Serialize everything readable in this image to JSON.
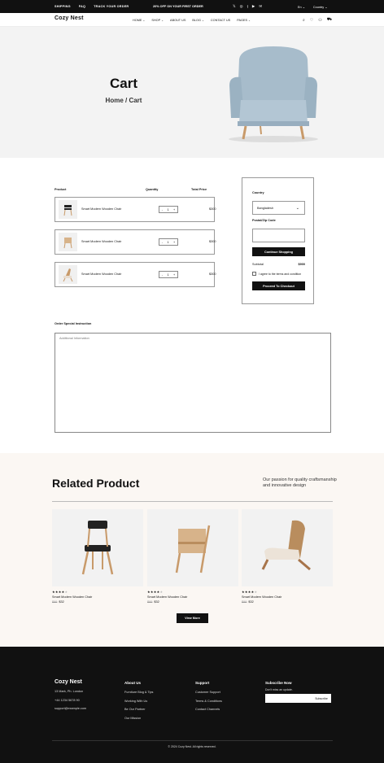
{
  "topbar": {
    "links": [
      "SHIPPING",
      "FAQ",
      "TRACK YOUR ORDER"
    ],
    "promo": "20% OFF ON YOUR FIRST ORDER",
    "social_icons": [
      "x-icon",
      "instagram-icon",
      "facebook-icon",
      "youtube-icon",
      "email-icon"
    ],
    "language": "En",
    "country": "Country"
  },
  "header": {
    "logo": "Cozy Nest",
    "nav": [
      "HOME",
      "SHOP",
      "ABOUT US",
      "BLOG",
      "CONTACT US",
      "PAGES"
    ],
    "nav_has_dropdown": [
      true,
      true,
      false,
      true,
      false,
      true
    ],
    "icons": [
      "search-icon",
      "heart-icon",
      "user-icon",
      "cart-icon"
    ]
  },
  "hero": {
    "title": "Cart",
    "breadcrumb": "Home / Cart"
  },
  "cart": {
    "columns": {
      "product": "Product",
      "quantity": "Quantity",
      "total": "Total Price"
    },
    "items": [
      {
        "name": "Smart Modern Wooden Chair",
        "qty": "1",
        "price": "$300"
      },
      {
        "name": "Smart Modern Wooden Chair",
        "qty": "1",
        "price": "$300"
      },
      {
        "name": "Smart Modern Wooden Chair",
        "qty": "1",
        "price": "$300"
      }
    ]
  },
  "summary": {
    "country_label": "Country",
    "country_value": "Bangladesh",
    "zip_label": "Postal/Zip Code",
    "continue_btn": "Continue Shopping",
    "subtotal_label": "Subtotal",
    "subtotal_value": "$900",
    "agree_text": "I agree to the terms and condition",
    "checkout_btn": "Proceed To Checkout"
  },
  "instructions": {
    "label": "Order Special Instruction",
    "placeholder": "Additional Information"
  },
  "related": {
    "title": "Related Product",
    "description": "Our passion for quality craftsmanship and innovative design",
    "products": [
      {
        "name": "Smart Modern Wooden Chair",
        "old_price": "$99",
        "price": "$32",
        "rating": 4
      },
      {
        "name": "Smart Modern Wooden Chair",
        "old_price": "$99",
        "price": "$32",
        "rating": 4
      },
      {
        "name": "Smart Modern Wooden Chair",
        "old_price": "$99",
        "price": "$32",
        "rating": 4
      }
    ],
    "view_more": "View More"
  },
  "footer": {
    "logo": "Cozy Nest",
    "contact": [
      "13 Mark, Ph. London",
      "+44 1234 5678 90",
      "support@example.com"
    ],
    "about_title": "About Us",
    "about_items": [
      "Furniture Blog & Tips",
      "Working With Us",
      "Be Our Partner",
      "Our Mission"
    ],
    "support_title": "Support",
    "support_items": [
      "Customer Support",
      "Terms & Conditions",
      "Contact Channels"
    ],
    "subscribe_title": "Subscribe Now",
    "subscribe_text": "Don't miss an update.",
    "subscribe_btn": "Subscribe",
    "copyright": "© 2024 Cozy Nest. All rights reserved."
  }
}
